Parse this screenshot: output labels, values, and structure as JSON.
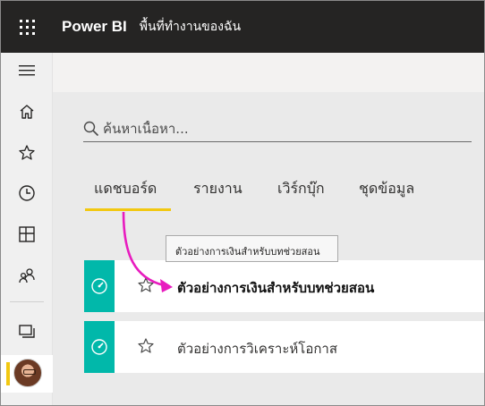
{
  "header": {
    "app_name": "Power BI",
    "workspace": "พื้นที่ทำงานของฉัน",
    "waffle_icon": "waffle-icon"
  },
  "leftnav": {
    "items": [
      {
        "name": "collapse-menu",
        "icon": "hamburger-icon"
      },
      {
        "name": "home",
        "icon": "home-icon"
      },
      {
        "name": "favorites",
        "icon": "star-icon"
      },
      {
        "name": "recent",
        "icon": "clock-icon"
      },
      {
        "name": "apps",
        "icon": "apps-icon"
      },
      {
        "name": "shared-with-me",
        "icon": "people-icon"
      },
      {
        "name": "workspaces",
        "icon": "workspaces-icon"
      }
    ],
    "accent_color": "#f2c811"
  },
  "search": {
    "placeholder": "ค้นหาเนื้อหา...",
    "value": ""
  },
  "tabs": [
    {
      "label": "แดชบอร์ด",
      "active": true
    },
    {
      "label": "รายงาน",
      "active": false
    },
    {
      "label": "เวิร์กบุ๊ก",
      "active": false
    },
    {
      "label": "ชุดข้อมูล",
      "active": false
    }
  ],
  "tooltip": {
    "text": "ตัวอย่างการเงินสำหรับบทช่วยสอน"
  },
  "dashboards": [
    {
      "name": "ตัวอย่างการเงินสำหรับบทช่วยสอน",
      "favorited": false,
      "icon": "dashboard-gauge-icon"
    },
    {
      "name": "ตัวอย่างการวิเคราะห์โอกาส",
      "favorited": false,
      "icon": "dashboard-gauge-icon"
    }
  ],
  "colors": {
    "header_bg": "#252423",
    "tile_teal": "#01b8aa",
    "tab_underline": "#f2c811",
    "annotation_arrow": "#e81cbf"
  }
}
